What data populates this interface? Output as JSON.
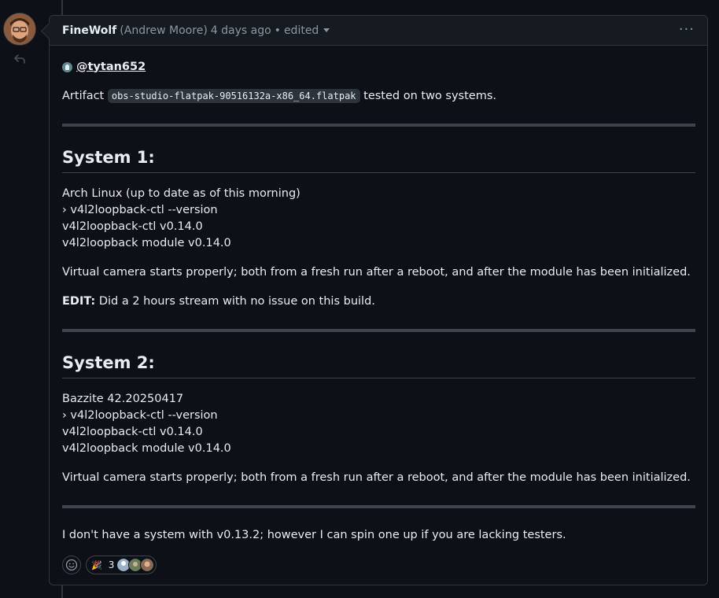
{
  "comment": {
    "author": "FineWolf",
    "full_name": "(Andrew Moore)",
    "time": "4 days ago",
    "separator": "•",
    "edited": "edited",
    "kebab": "···"
  },
  "body": {
    "mention": "@tytan652",
    "artifact_prefix": "Artifact",
    "artifact_code": "obs-studio-flatpak-90516132a-x86_64.flatpak",
    "artifact_suffix": "tested on two systems.",
    "system1": {
      "heading": "System 1:",
      "lines": [
        "Arch Linux (up to date as of this morning)",
        "› v4l2loopback-ctl --version",
        "v4l2loopback-ctl v0.14.0",
        "v4l2loopback module v0.14.0"
      ],
      "status": "Virtual camera starts properly; both from a fresh run after a reboot, and after the module has been initialized.",
      "edit_label": "EDIT:",
      "edit_text": "Did a 2 hours stream with no issue on this build."
    },
    "system2": {
      "heading": "System 2:",
      "lines": [
        "Bazzite 42.20250417",
        "› v4l2loopback-ctl --version",
        "v4l2loopback-ctl v0.14.0",
        "v4l2loopback module v0.14.0"
      ],
      "status": "Virtual camera starts properly; both from a fresh run after a reboot, and after the module has been initialized."
    },
    "closing": "I don't have a system with v0.13.2; however I can spin one up if you are lacking testers."
  },
  "reactions": {
    "tada_count": "3",
    "tada_glyph": "🎉"
  },
  "colors": {
    "background": "#0d1117",
    "header_bg": "#161b22",
    "border": "#30363d",
    "text": "#e6edf3",
    "muted": "#8d96a0"
  }
}
